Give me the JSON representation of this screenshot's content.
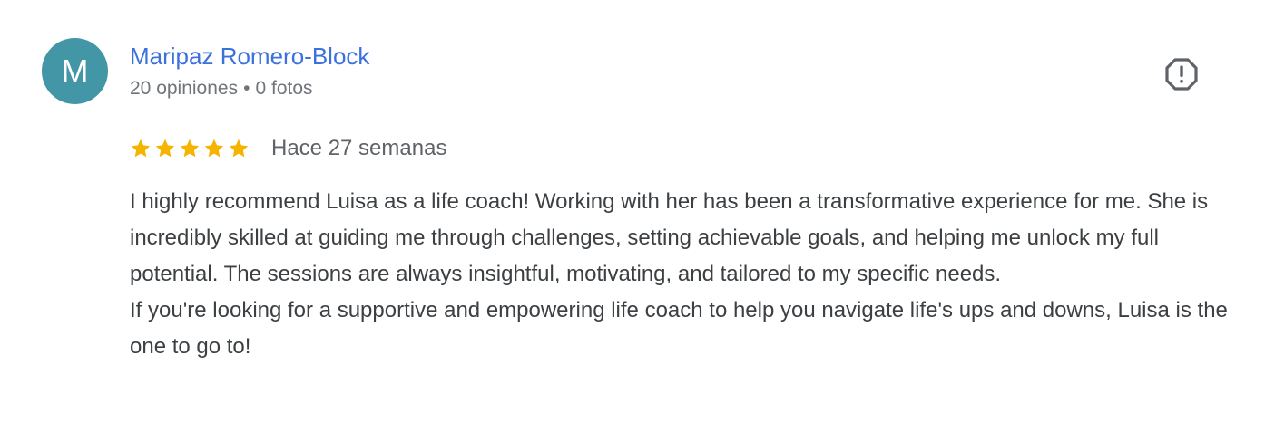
{
  "reviewer": {
    "initial": "M",
    "name": "Maripaz Romero-Block",
    "reviews_count": "20 opiniones",
    "separator": "•",
    "photos_count": "0 fotos",
    "avatar_color": "#4296a5",
    "name_color": "#3b71de"
  },
  "actions": {
    "report_icon": "report-flag-icon"
  },
  "review": {
    "rating": 5,
    "max_rating": 5,
    "star_color": "#f4b400",
    "date": "Hace 27 semanas",
    "paragraphs": [
      "I highly recommend Luisa as a life coach! Working with her has been a transformative experience for me. She is incredibly skilled at guiding me through challenges, setting achievable goals, and helping me unlock my full potential. The sessions are always insightful, motivating, and tailored to my specific needs.",
      "If you're looking for a supportive and empowering life coach to help you navigate life's ups and downs, Luisa is the one to go to!"
    ]
  }
}
